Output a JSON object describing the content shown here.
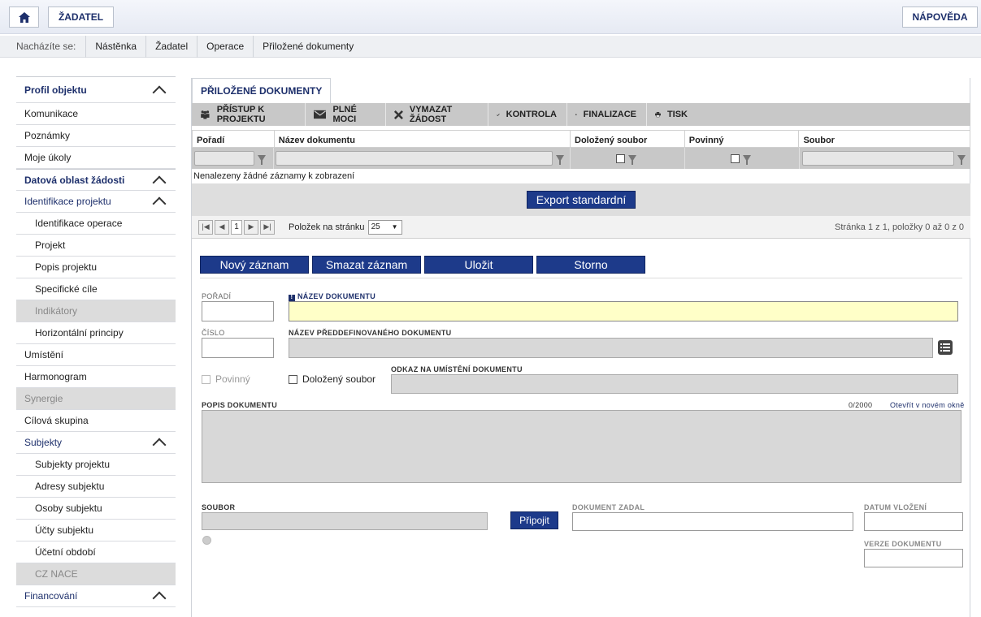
{
  "topbar": {
    "zadatel": "ŽADATEL",
    "help": "NÁPOVĚDA"
  },
  "breadcrumb": {
    "label": "Nacházíte se:",
    "items": [
      "Nástěnka",
      "Žadatel",
      "Operace",
      "Přiložené dokumenty"
    ]
  },
  "sidebar": {
    "items": [
      "Profil objektu",
      "Komunikace",
      "Poznámky",
      "Moje úkoly",
      "Datová oblast žádosti",
      "Identifikace projektu",
      "Identifikace operace",
      "Projekt",
      "Popis projektu",
      "Specifické cíle",
      "Indikátory",
      "Horizontální principy",
      "Umístění",
      "Harmonogram",
      "Synergie",
      "Cílová skupina",
      "Subjekty",
      "Subjekty projektu",
      "Adresy subjektu",
      "Osoby subjektu",
      "Účty subjektu",
      "Účetní období",
      "CZ NACE",
      "Financování"
    ]
  },
  "tab": "PŘILOŽENÉ DOKUMENTY",
  "toolbar": [
    "PŘÍSTUP K PROJEKTU",
    "PLNÉ MOCI",
    "VYMAZAT ŽÁDOST",
    "KONTROLA",
    "FINALIZACE",
    "TISK"
  ],
  "grid": {
    "columns": [
      "Pořadí",
      "Název dokumentu",
      "Doložený soubor",
      "Povinný",
      "Soubor"
    ],
    "empty": "Nenalezeny žádné záznamy k zobrazení",
    "export": "Export standardní"
  },
  "pager": {
    "page": "1",
    "per_page_label": "Položek na stránku",
    "per_page": "25",
    "info": "Stránka 1 z 1, položky 0 až 0 z 0"
  },
  "actions": [
    "Nový záznam",
    "Smazat záznam",
    "Uložit",
    "Storno"
  ],
  "form": {
    "poradi": "POŘADÍ",
    "nazev": "NÁZEV DOKUMENTU",
    "cislo": "ČÍSLO",
    "predef": "NÁZEV PŘEDDEFINOVANÉHO DOKUMENTU",
    "povinny": "Povinný",
    "dolozeny": "Doložený soubor",
    "odkaz": "ODKAZ NA UMÍSTĚNÍ DOKUMENTU",
    "popis": "POPIS DOKUMENTU",
    "counter": "0/2000",
    "open_new": "Otevřít v novém okně",
    "soubor": "SOUBOR",
    "pripojit": "Připojit",
    "zadal": "DOKUMENT ZADAL",
    "datum": "DATUM VLOŽENÍ",
    "verze": "VERZE DOKUMENTU"
  }
}
